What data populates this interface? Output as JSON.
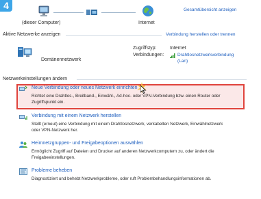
{
  "step_number": "4",
  "top_map": {
    "computer_label": "(dieser Computer)",
    "internet_label": "Internet",
    "full_map_link": "Gesamtübersicht anzeigen"
  },
  "active_networks": {
    "title": "Aktive Netzwerke anzeigen",
    "connect_link": "Verbindung herstellen oder trennen",
    "network_name": "Domänennetzwerk",
    "access_type_label": "Zugriffstyp:",
    "access_type_value": "Internet",
    "connections_label": "Verbindungen:",
    "connection_link_line1": "Drahtlosnetzwerkverbindung",
    "connection_link_line2": "(Lan)"
  },
  "change_settings": {
    "title": "Netzwerkeinstellungen ändern",
    "tasks": [
      {
        "title": "Neue Verbindung oder neues Netzwerk einrichten",
        "desc_line1": "Richtet eine Drahtlos-, Breitband-, Einwähl-, Ad-hoc- oder VPN-Verbindung bzw. einen Router oder",
        "desc_line2": "Zugriffspunkt ein."
      },
      {
        "title": "Verbindung mit einem Netzwerk herstellen",
        "desc_line1": "Stellt (erneut) eine Verbindung mit einem Drahtlosnetzwerk, verkabelten Netzwerk, Einwählnetzwerk",
        "desc_line2": "oder VPN-Netzwerk her."
      },
      {
        "title": "Heimnetzgruppen- und Freigabeoptionen auswählen",
        "desc_line1": "Ermöglicht Zugriff auf Dateien und Drucker auf anderen Netzwerkcomputern zu, oder ändert die",
        "desc_line2": "Freigabeeinstellungen."
      },
      {
        "title": "Probleme beheben",
        "desc_line1": "Diagnostiziert und behebt Netzwerkprobleme, oder ruft Problembehandlungsinformationen ab.",
        "desc_line2": ""
      }
    ]
  },
  "colors": {
    "link": "#1e5fbf",
    "highlight_border": "#e0433c",
    "highlight_fill": "#fbe8e8",
    "badge": "#3ea6e8"
  }
}
